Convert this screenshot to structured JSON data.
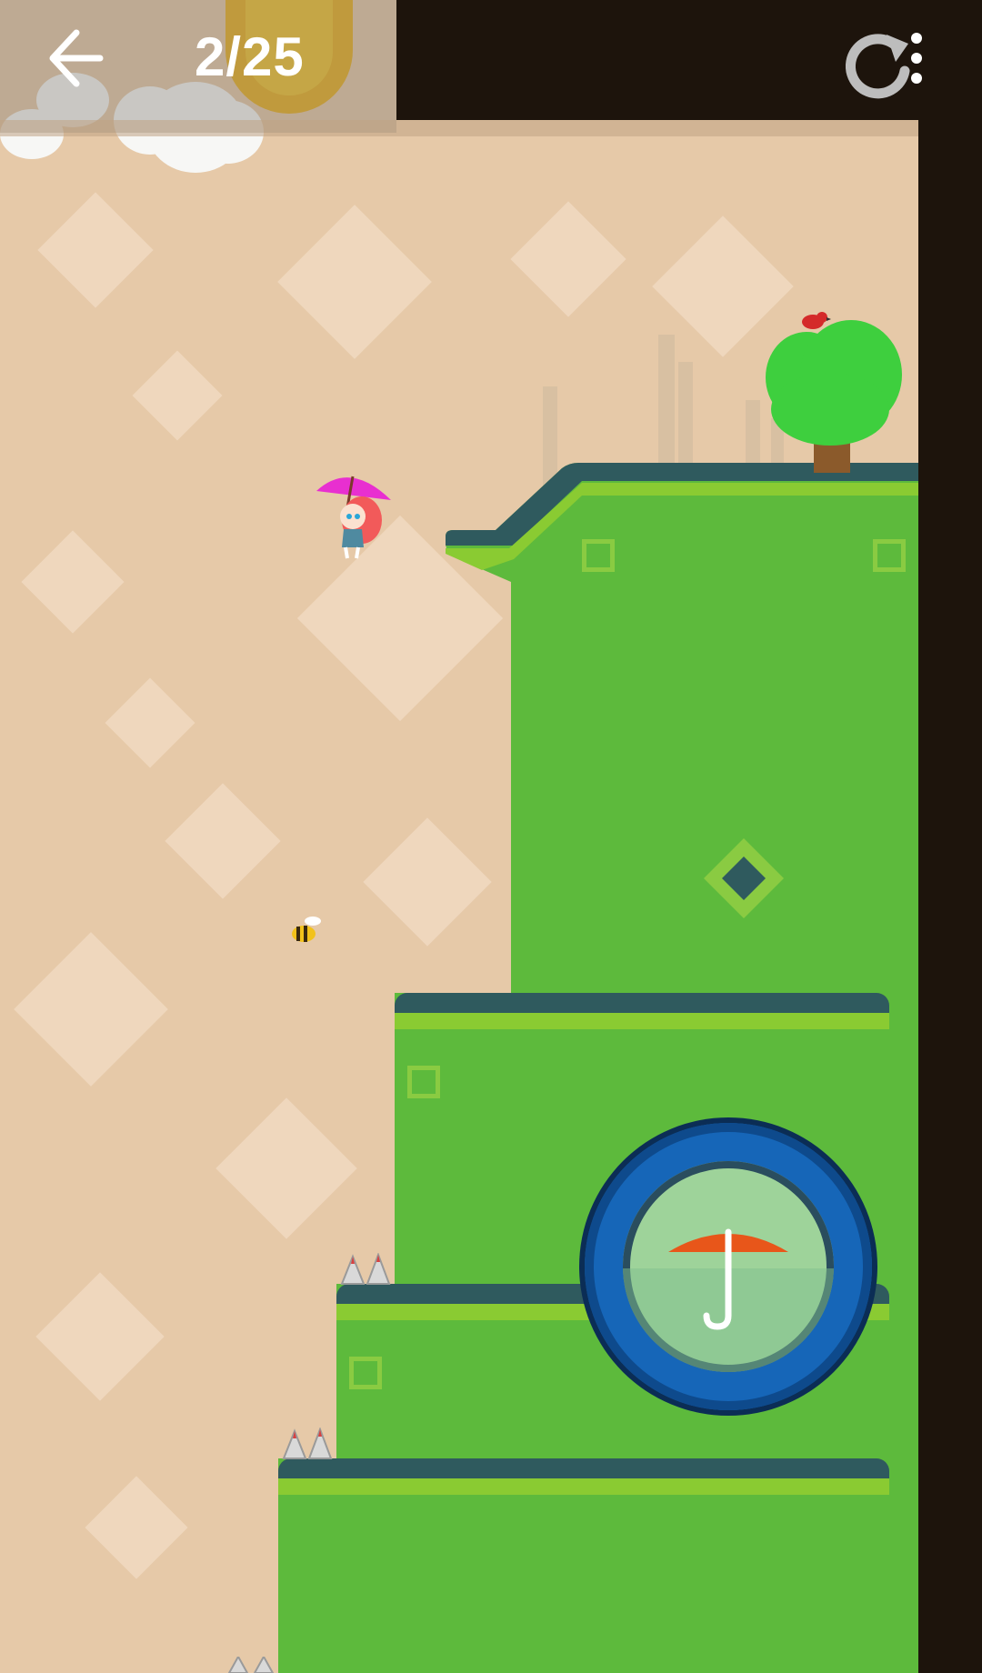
{
  "header": {
    "level_progress": "2/25"
  },
  "icons": {
    "back": "arrow-left-icon",
    "restart": "restart-icon",
    "menu": "vertical-dots-icon",
    "umbrella": "umbrella-icon"
  },
  "colors": {
    "ground": "#5dba3c",
    "ledge": "#2f5a5e",
    "grass": "#8acb32",
    "wall": "#1d140c",
    "background": "#e6c9a8",
    "button_ring": "#1666b8",
    "umbrella": "#e8561a"
  }
}
